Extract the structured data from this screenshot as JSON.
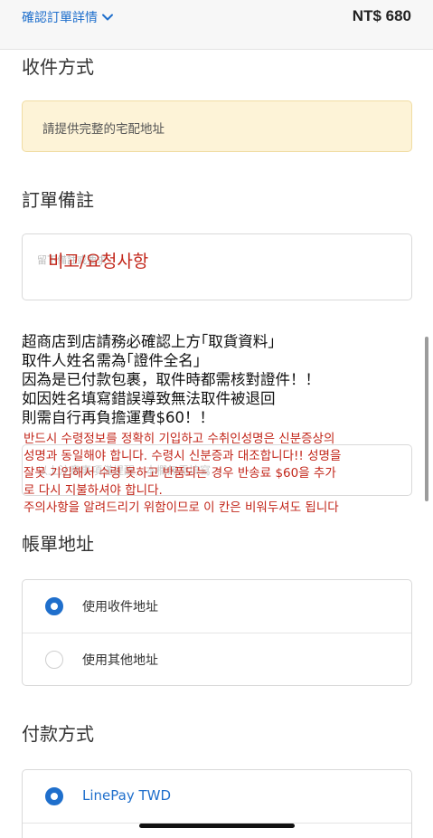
{
  "header": {
    "summary_label": "確認訂單詳情",
    "summary_icon": "chevron-down-icon",
    "total": "NT$ 680"
  },
  "shipping": {
    "title": "收件方式",
    "warning": "請提供完整的宅配地址"
  },
  "order_note": {
    "title": "訂單備註",
    "placeholder": "留下備註或要求",
    "overlay_text": "비고/요청사항"
  },
  "store_notice": {
    "lines": [
      "超商店到店請務必確認上方｢取貨資料」",
      "取件人姓名需為｢證件全名」",
      "因為是已付款包裹，取件時都需核對證件！！",
      "如因姓名填寫錯誤導致無法取件被退回",
      "則需自行再負擔運費$60！！"
    ],
    "field_placeholder": "以上注意事項僅提醒，本欄無需填寫"
  },
  "korean_notice": {
    "lines": [
      "반드시 수령정보를 정확히 기입하고 수취인성명은 신분증상의",
      "성명과 동일해야 합니다. 수령시 신분증과 대조합니다!! 성명을",
      "잘못 기입해서 수령 못하고 반품되는 경우 반송료 $60을 추가",
      "로 다시 지불하셔야 합니다.",
      "주의사항을 알려드리기 위함이므로 이 칸은 비워두셔도 됩니다"
    ]
  },
  "billing": {
    "title": "帳單地址",
    "options": [
      {
        "label": "使用收件地址",
        "selected": true
      },
      {
        "label": "使用其他地址",
        "selected": false
      }
    ]
  },
  "payment": {
    "title": "付款方式",
    "options": [
      {
        "label": "LinePay TWD",
        "selected": true
      }
    ]
  },
  "colors": {
    "accent": "#1f6fcc",
    "warning_bg": "#fdf3d7",
    "annotation_red": "#c2261a"
  }
}
